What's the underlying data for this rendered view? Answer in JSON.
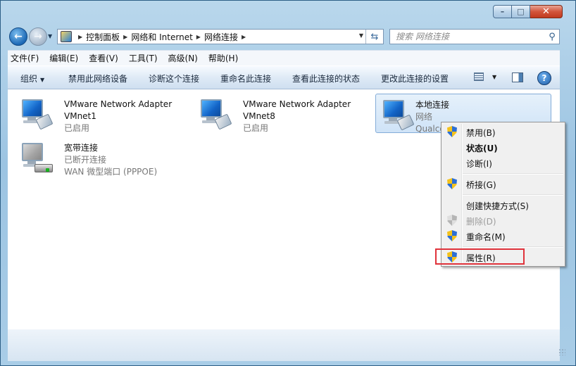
{
  "window": {
    "buttons": {
      "minimize": "–",
      "maximize": "□",
      "close": "✕"
    }
  },
  "nav": {
    "back_icon": "back-arrow-icon",
    "forward_icon": "forward-arrow-icon"
  },
  "address": {
    "breadcrumbs": [
      "控制面板",
      "网络和 Internet",
      "网络连接"
    ]
  },
  "search": {
    "placeholder": "搜索 网络连接"
  },
  "menu": [
    "文件(F)",
    "编辑(E)",
    "查看(V)",
    "工具(T)",
    "高级(N)",
    "帮助(H)"
  ],
  "commands": {
    "organize": "组织",
    "disable": "禁用此网络设备",
    "diagnose": "诊断这个连接",
    "rename": "重命名此连接",
    "view_status": "查看此连接的状态",
    "change_settings": "更改此连接的设置",
    "help": "?"
  },
  "connections": [
    {
      "name": "VMware Network Adapter",
      "line2": "VMnet1",
      "status": "已启用"
    },
    {
      "name": "VMware Network Adapter",
      "line2": "VMnet8",
      "status": "已启用"
    },
    {
      "name": "本地连接",
      "line2": "网络",
      "status": "Qualco"
    },
    {
      "name": "宽带连接",
      "line2": "已断开连接",
      "status": "WAN 微型端口 (PPPOE)"
    }
  ],
  "context_menu": {
    "items": [
      "禁用(B)",
      "状态(U)",
      "诊断(I)",
      "桥接(G)",
      "创建快捷方式(S)",
      "删除(D)",
      "重命名(M)",
      "属性(R)"
    ]
  },
  "colors": {
    "highlight": "#e0333b",
    "accent": "#1263c6"
  }
}
